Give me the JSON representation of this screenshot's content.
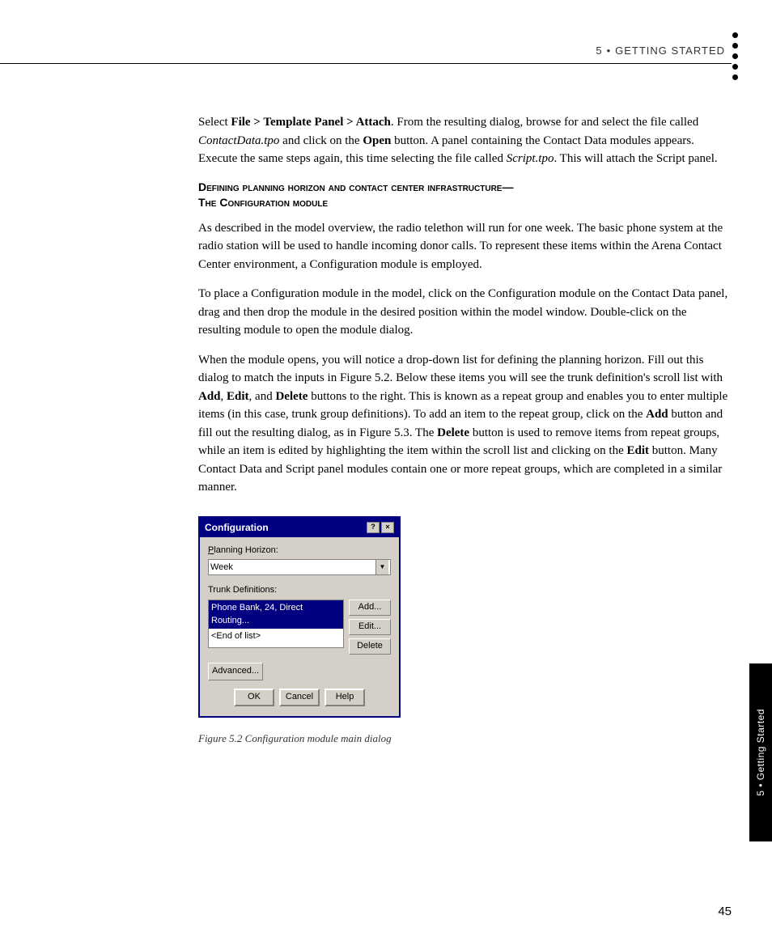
{
  "header": {
    "chapter": "5",
    "separator": "•",
    "title": "Getting Started"
  },
  "sidetab": {
    "text": "5 • Getting Started"
  },
  "page_number": "45",
  "content": {
    "para1": "Select File > Template Panel > Attach. From the resulting dialog, browse for and select the file called ContactData.tpo and click on the Open button. A panel containing the Contact Data modules appears. Execute the same steps again, this time selecting the file called Script.tpo. This will attach the Script panel.",
    "section_heading": "Defining planning horizon and contact center infrastructure—\nThe Configuration module",
    "para2": "As described in the model overview, the radio telethon will run for one week. The basic phone system at the radio station will be used to handle incoming donor calls. To represent these items within the Arena Contact Center environment, a Configuration module is employed.",
    "para3": "To place a Configuration module in the model, click on the Configuration module on the Contact Data panel, drag and then drop the module in the desired position within the model window. Double-click on the resulting module to open the module dialog.",
    "para4": "When the module opens, you will notice a drop-down list for defining the planning horizon. Fill out this dialog to match the inputs in Figure 5.2. Below these items you will see the trunk definition's scroll list with Add, Edit, and Delete buttons to the right. This is known as a repeat group and enables you to enter multiple items (in this case, trunk group definitions). To add an item to the repeat group, click on the Add button and fill out the resulting dialog, as in Figure 5.3. The Delete button is used to remove items from repeat groups, while an item is edited by highlighting the item within the scroll list and clicking on the Edit button. Many Contact Data and Script panel modules contain one or more repeat groups, which are completed in a similar manner.",
    "figure_caption": "Figure 5.2 Configuration module main dialog"
  },
  "dialog": {
    "title": "Configuration",
    "help_btn": "?",
    "close_btn": "×",
    "planning_horizon_label": "Planning Horizon:",
    "planning_horizon_underline_char": "P",
    "dropdown_value": "Week",
    "trunk_def_label": "Trunk Definitions:",
    "trunk_list_items": [
      {
        "text": "Phone Bank, 24, Direct Routing...",
        "selected": true
      },
      {
        "text": "<End of list>",
        "selected": false
      }
    ],
    "btn_add": "Add...",
    "btn_edit": "Edit...",
    "btn_delete": "Delete",
    "btn_advanced": "Advanced...",
    "btn_ok": "OK",
    "btn_cancel": "Cancel",
    "btn_help": "Help"
  },
  "bullets": 5
}
